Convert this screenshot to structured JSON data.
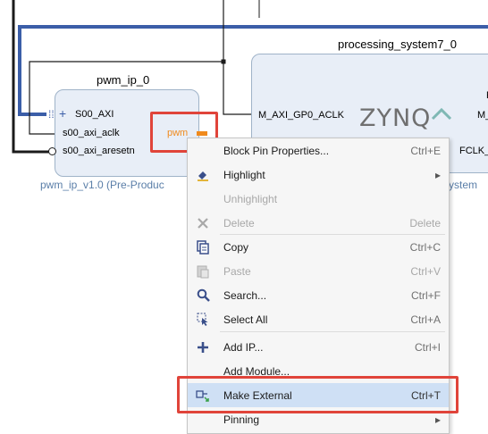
{
  "diagram": {
    "pwm_block": {
      "title": "pwm_ip_0",
      "subtitle": "pwm_ip_v1.0 (Pre-Produc",
      "ports": [
        "S00_AXI",
        "s00_axi_aclk",
        "s00_axi_aresetn"
      ],
      "out_port": "pwm"
    },
    "ps_block": {
      "title": "processing_system7_0",
      "subtitle_tail": "ystem",
      "ports_left": [
        "M_AXI_GP0_ACLK"
      ],
      "ports_right_partial": [
        "F",
        "M_",
        "FCLK_"
      ],
      "logo": "ZYNQ"
    }
  },
  "context_menu": {
    "items": [
      {
        "label": "Block Pin Properties...",
        "shortcut": "Ctrl+E",
        "icon": "none",
        "enabled": true
      },
      {
        "label": "Highlight",
        "shortcut": "",
        "icon": "highlight-brush-icon",
        "enabled": true,
        "submenu": true
      },
      {
        "label": "Unhighlight",
        "shortcut": "",
        "icon": "none",
        "enabled": false
      },
      {
        "label": "Delete",
        "shortcut": "Delete",
        "icon": "delete-x-icon",
        "enabled": false
      },
      {
        "label": "Copy",
        "shortcut": "Ctrl+C",
        "icon": "copy-icon",
        "enabled": true
      },
      {
        "label": "Paste",
        "shortcut": "Ctrl+V",
        "icon": "paste-icon",
        "enabled": false
      },
      {
        "label": "Search...",
        "shortcut": "Ctrl+F",
        "icon": "search-icon",
        "enabled": true
      },
      {
        "label": "Select All",
        "shortcut": "Ctrl+A",
        "icon": "select-all-icon",
        "enabled": true
      },
      {
        "label": "Add IP...",
        "shortcut": "Ctrl+I",
        "icon": "add-plus-icon",
        "enabled": true
      },
      {
        "label": "Add Module...",
        "shortcut": "",
        "icon": "none",
        "enabled": true
      },
      {
        "label": "Make External",
        "shortcut": "Ctrl+T",
        "icon": "make-external-icon",
        "enabled": true,
        "selected": true
      },
      {
        "label": "Pinning",
        "shortcut": "",
        "icon": "none",
        "enabled": true,
        "submenu": true
      }
    ],
    "submenu_arrow": "▸"
  },
  "colors": {
    "block_fill": "#e8eef7",
    "bus_wire": "#3b5ea8",
    "highlight_red": "#e0443a",
    "pwm_orange": "#f08a1c",
    "menu_selected": "#cfe0f5"
  }
}
